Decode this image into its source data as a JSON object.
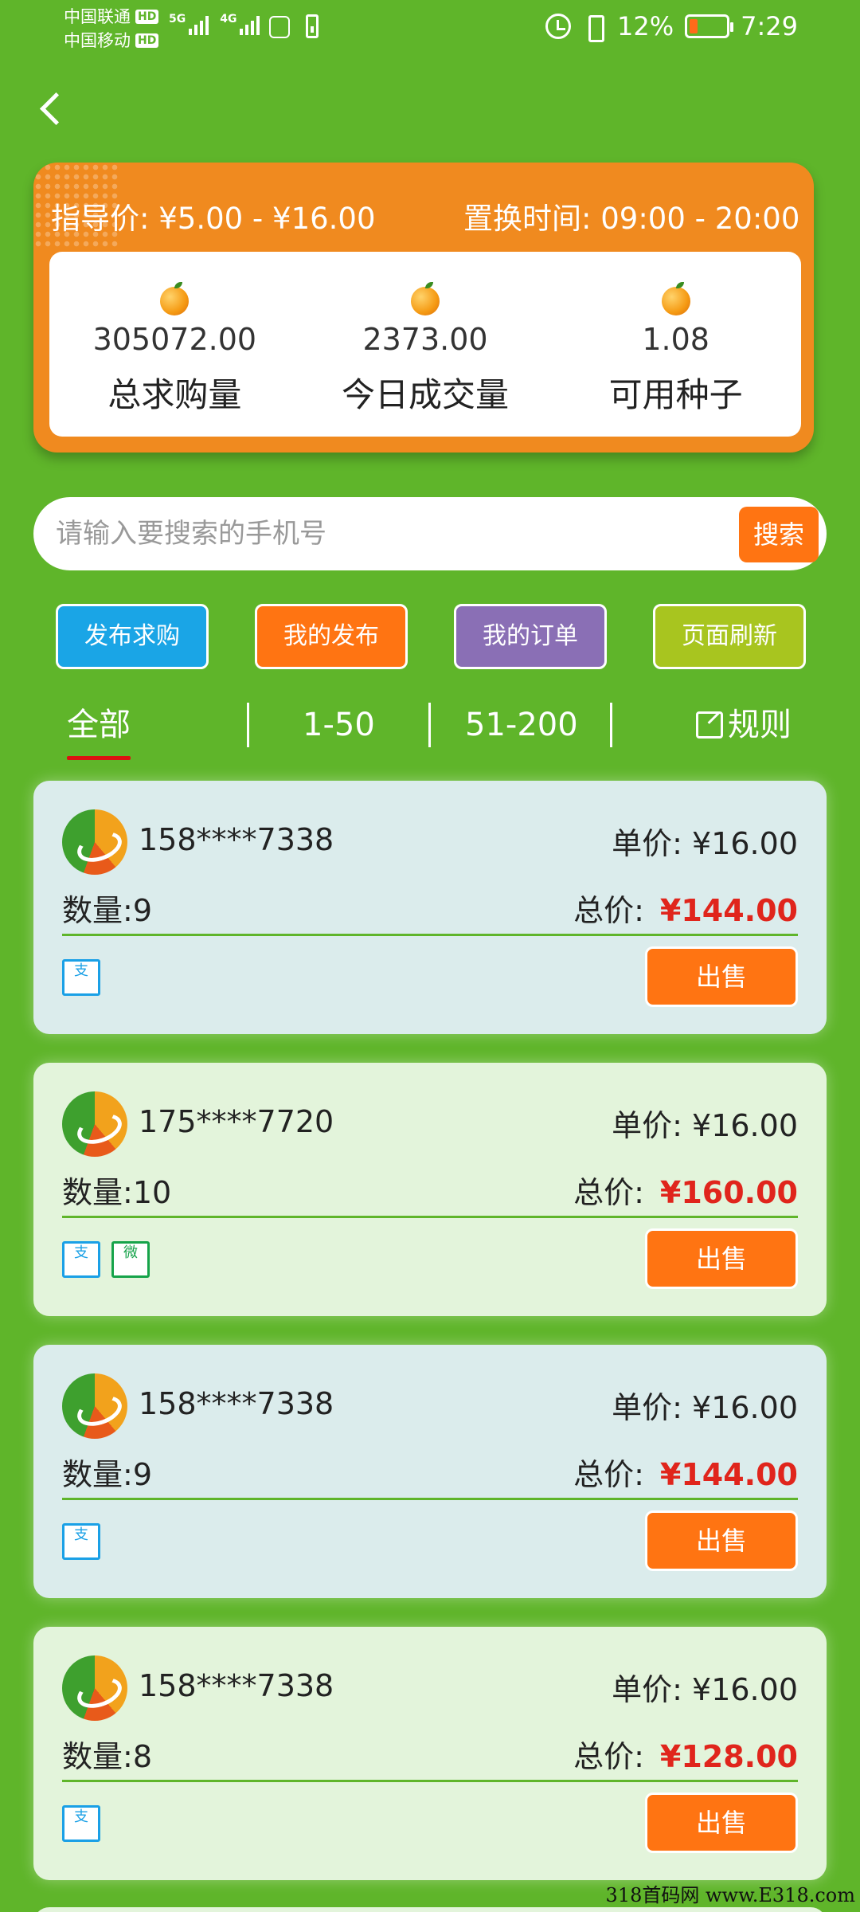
{
  "status_bar": {
    "carrier1": "中国联通",
    "carrier2": "中国移动",
    "hd": "HD",
    "net1": "5G",
    "net2": "4G",
    "battery_pct": "12%",
    "time": "7:29"
  },
  "header": {
    "price_label": "指导价:",
    "price_range": "¥5.00 - ¥16.00",
    "time_label": "置换时间:",
    "time_range": "09:00 - 20:00",
    "stats": [
      {
        "value": "305072.00",
        "label": "总求购量",
        "icon": "orange-icon"
      },
      {
        "value": "2373.00",
        "label": "今日成交量",
        "icon": "orange-icon"
      },
      {
        "value": "1.08",
        "label": "可用种子",
        "icon": "orange-icon"
      }
    ]
  },
  "search": {
    "placeholder": "请输入要搜索的手机号",
    "button": "搜索"
  },
  "actions": [
    {
      "label": "发布求购",
      "color": "#1aa5e6"
    },
    {
      "label": "我的发布",
      "color": "#ff7412"
    },
    {
      "label": "我的订单",
      "color": "#8a6fb5"
    },
    {
      "label": "页面刷新",
      "color": "#a8c51f"
    }
  ],
  "tabs": {
    "all": "全部",
    "range1": "1-50",
    "range2": "51-200",
    "rules": "规则"
  },
  "orders": [
    {
      "phone": "158****7338",
      "unit_label": "单价:",
      "unit_price": "¥16.00",
      "qty_label": "数量:",
      "qty": "9",
      "total_label": "总价:",
      "total": "¥144.00",
      "pay": [
        "alipay"
      ],
      "action": "出售"
    },
    {
      "phone": "175****7720",
      "unit_label": "单价:",
      "unit_price": "¥16.00",
      "qty_label": "数量:",
      "qty": "10",
      "total_label": "总价:",
      "total": "¥160.00",
      "pay": [
        "alipay",
        "wechat"
      ],
      "action": "出售"
    },
    {
      "phone": "158****7338",
      "unit_label": "单价:",
      "unit_price": "¥16.00",
      "qty_label": "数量:",
      "qty": "9",
      "total_label": "总价:",
      "total": "¥144.00",
      "pay": [
        "alipay"
      ],
      "action": "出售"
    },
    {
      "phone": "158****7338",
      "unit_label": "单价:",
      "unit_price": "¥16.00",
      "qty_label": "数量:",
      "qty": "8",
      "total_label": "总价:",
      "total": "¥128.00",
      "pay": [
        "alipay"
      ],
      "action": "出售"
    }
  ],
  "pay_icons": {
    "alipay": "支",
    "wechat": "微"
  },
  "watermark": "318首码网 www.E318.com"
}
